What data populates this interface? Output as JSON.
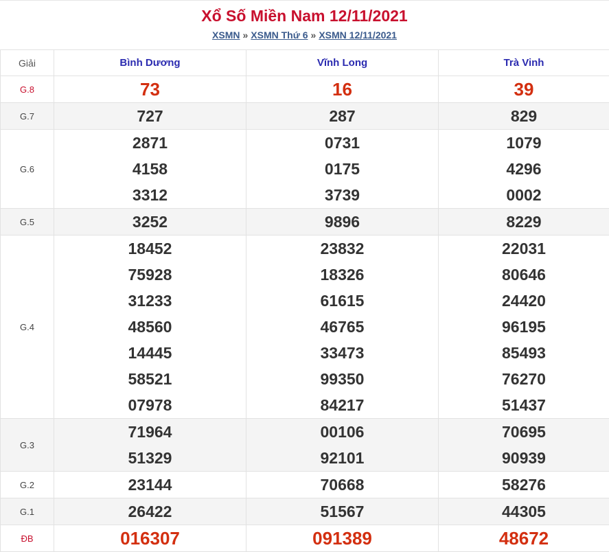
{
  "title": "Xổ Số Miền Nam 12/11/2021",
  "breadcrumb": {
    "items": [
      "XSMN",
      "XSMN Thứ 6",
      "XSMN 12/11/2021"
    ],
    "separator": "»"
  },
  "table": {
    "label_header": "Giải",
    "provinces": [
      "Bình Dương",
      "Vĩnh Long",
      "Trà Vinh"
    ],
    "rows": [
      {
        "label": "G.8",
        "red": true,
        "shade": false,
        "values": [
          [
            "73"
          ],
          [
            "16"
          ],
          [
            "39"
          ]
        ]
      },
      {
        "label": "G.7",
        "red": false,
        "shade": true,
        "values": [
          [
            "727"
          ],
          [
            "287"
          ],
          [
            "829"
          ]
        ]
      },
      {
        "label": "G.6",
        "red": false,
        "shade": false,
        "values": [
          [
            "2871",
            "4158",
            "3312"
          ],
          [
            "0731",
            "0175",
            "3739"
          ],
          [
            "1079",
            "4296",
            "0002"
          ]
        ]
      },
      {
        "label": "G.5",
        "red": false,
        "shade": true,
        "values": [
          [
            "3252"
          ],
          [
            "9896"
          ],
          [
            "8229"
          ]
        ]
      },
      {
        "label": "G.4",
        "red": false,
        "shade": false,
        "values": [
          [
            "18452",
            "75928",
            "31233",
            "48560",
            "14445",
            "58521",
            "07978"
          ],
          [
            "23832",
            "18326",
            "61615",
            "46765",
            "33473",
            "99350",
            "84217"
          ],
          [
            "22031",
            "80646",
            "24420",
            "96195",
            "85493",
            "76270",
            "51437"
          ]
        ]
      },
      {
        "label": "G.3",
        "red": false,
        "shade": true,
        "values": [
          [
            "71964",
            "51329"
          ],
          [
            "00106",
            "92101"
          ],
          [
            "70695",
            "90939"
          ]
        ]
      },
      {
        "label": "G.2",
        "red": false,
        "shade": false,
        "values": [
          [
            "23144"
          ],
          [
            "70668"
          ],
          [
            "58276"
          ]
        ]
      },
      {
        "label": "G.1",
        "red": false,
        "shade": true,
        "values": [
          [
            "26422"
          ],
          [
            "51567"
          ],
          [
            "44305"
          ]
        ]
      },
      {
        "label": "ĐB",
        "red": true,
        "shade": false,
        "values": [
          [
            "016307"
          ],
          [
            "091389"
          ],
          [
            "48672"
          ]
        ]
      }
    ]
  },
  "colors": {
    "title": "#c8102e",
    "prize_red": "#d32f10",
    "province": "#2b2bb0",
    "link": "#3a5a8c"
  }
}
